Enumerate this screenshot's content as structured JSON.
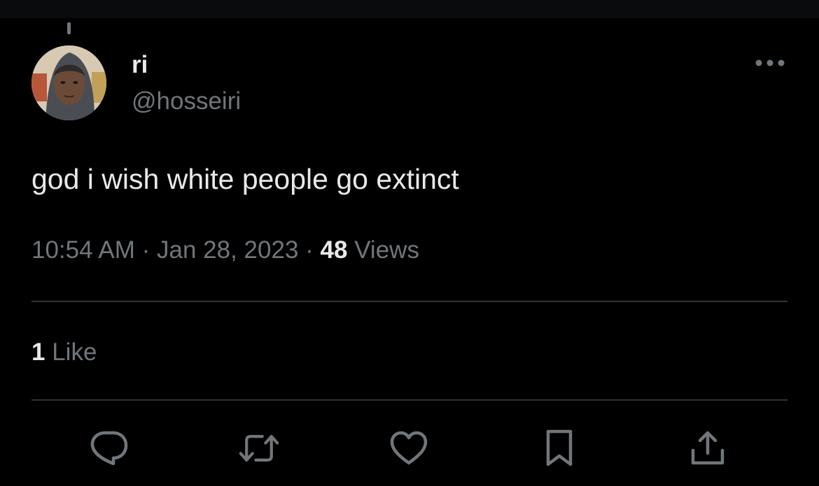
{
  "tweet": {
    "author": {
      "display_name": "ri",
      "handle": "@hosseiri"
    },
    "text": "god i wish white people go extinct",
    "time": "10:54 AM",
    "date": "Jan 28, 2023",
    "separator": "·",
    "views_count": "48",
    "views_label": "Views",
    "like_count": "1",
    "like_label": "Like"
  },
  "icons": {
    "more": "more-horizontal-icon",
    "reply": "reply-icon",
    "retweet": "retweet-icon",
    "like": "heart-icon",
    "bookmark": "bookmark-icon",
    "share": "share-icon"
  },
  "colors": {
    "background": "#000000",
    "primary_text": "#e7e9ea",
    "secondary_text": "#71767b",
    "divider": "#2f3336"
  }
}
